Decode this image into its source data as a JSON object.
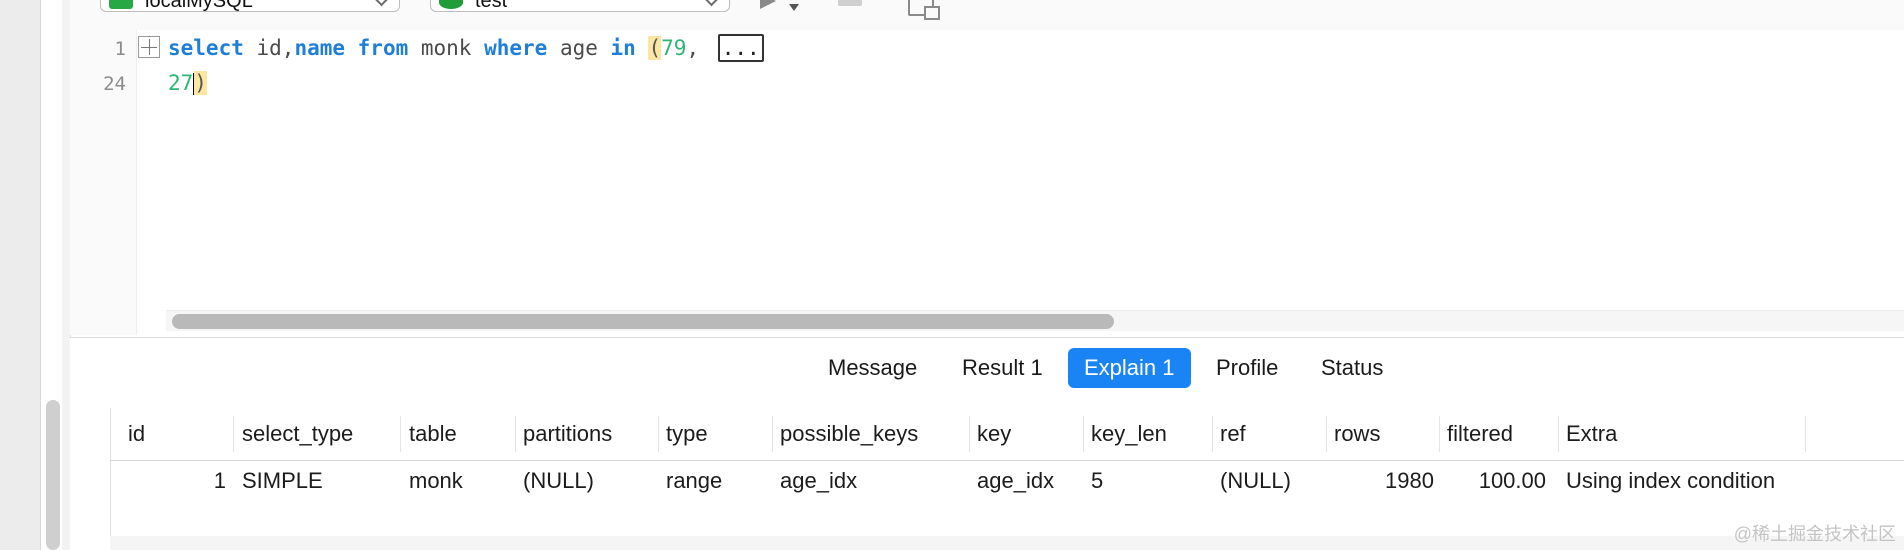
{
  "toolbar": {
    "connection": "localMySQL",
    "database": "test"
  },
  "editor": {
    "line_numbers": [
      "1",
      "24"
    ],
    "line1": {
      "kw_select": "select",
      "id": " id,",
      "kw_name": "name",
      "kw_from": " from",
      "table": " monk ",
      "kw_where": "where",
      "col": " age ",
      "kw_in": "in",
      "open_paren": "(",
      "first_value": "79",
      "comma": ", ",
      "folded": "..."
    },
    "line2": {
      "last_value": "27",
      "close_paren": ")"
    }
  },
  "tabs": [
    "Message",
    "Result 1",
    "Explain 1",
    "Profile",
    "Status"
  ],
  "active_tab": "Explain 1",
  "table": {
    "headers": [
      "id",
      "select_type",
      "table",
      "partitions",
      "type",
      "possible_keys",
      "key",
      "key_len",
      "ref",
      "rows",
      "filtered",
      "Extra"
    ],
    "row": [
      "1",
      "SIMPLE",
      "monk",
      "(NULL)",
      "range",
      "age_idx",
      "age_idx",
      "5",
      "(NULL)",
      "1980",
      "100.00",
      "Using index condition"
    ]
  },
  "watermark": "@稀土掘金技术社区",
  "colors": {
    "keyword": "#1f7fd8",
    "number": "#2bb673",
    "active_tab": "#1b84f5",
    "null_text": "#a3a3a3"
  }
}
